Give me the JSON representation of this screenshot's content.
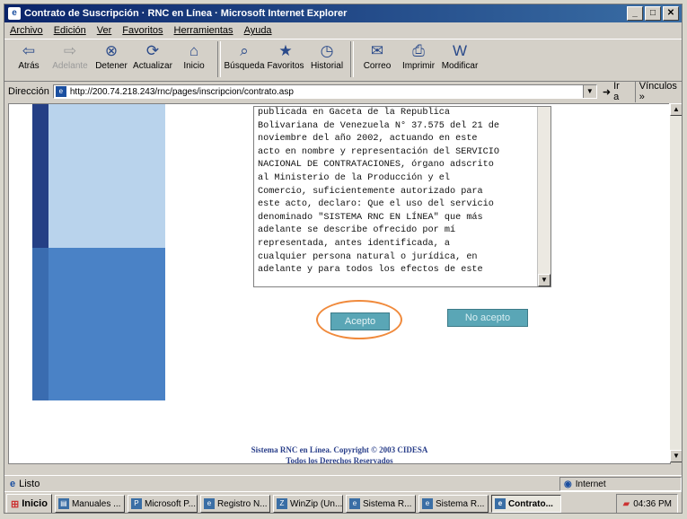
{
  "window": {
    "title": "Contrato de Suscripción · RNC en Línea · Microsoft Internet Explorer",
    "controls": [
      "_",
      "□",
      "✕"
    ]
  },
  "menu": [
    "Archivo",
    "Edición",
    "Ver",
    "Favoritos",
    "Herramientas",
    "Ayuda"
  ],
  "toolbar": {
    "back": "Atrás",
    "forward": "Adelante",
    "stop": "Detener",
    "refresh": "Actualizar",
    "home": "Inicio",
    "search": "Búsqueda",
    "favorites": "Favoritos",
    "history": "Historial",
    "mail": "Correo",
    "print": "Imprimir",
    "edit": "Modificar"
  },
  "address": {
    "label": "Dirección",
    "url": "http://200.74.218.243/rnc/pages/inscripcion/contrato.asp",
    "go": "Ir a",
    "links": "Vínculos »"
  },
  "page": {
    "contract_text": "publicada en Gaceta de la Republica\nBolivariana de Venezuela N° 37.575 del 21 de\nnoviembre del año 2002, actuando en este\nacto en nombre y representación del SERVICIO\nNACIONAL DE CONTRATACIONES, órgano adscrito\nal Ministerio de la Producción y el\nComercio, suficientemente autorizado para\neste acto, declaro: Que el uso del servicio\ndenominado \"SISTEMA RNC EN LÍNEA\" que más\nadelante se describe ofrecido por mí\nrepresentada, antes identificada, a\ncualquier persona natural o jurídica, en\nadelante y para todos los efectos de este",
    "accept_button": "Acepto",
    "reject_button": "No acepto",
    "footer_line1": "Sistema RNC en Línea. Copyright © 2003 CIDESA",
    "footer_line2": "Todos los Derechos Reservados"
  },
  "status": {
    "text": "Listo",
    "zone": "Internet"
  },
  "taskbar": {
    "start": "Inicio",
    "tasks": [
      "Manuales ...",
      "Microsoft P...",
      "Registro N...",
      "WinZip (Un...",
      "Sistema R...",
      "Sistema R...",
      "Contrato..."
    ],
    "clock": "04:36 PM"
  }
}
